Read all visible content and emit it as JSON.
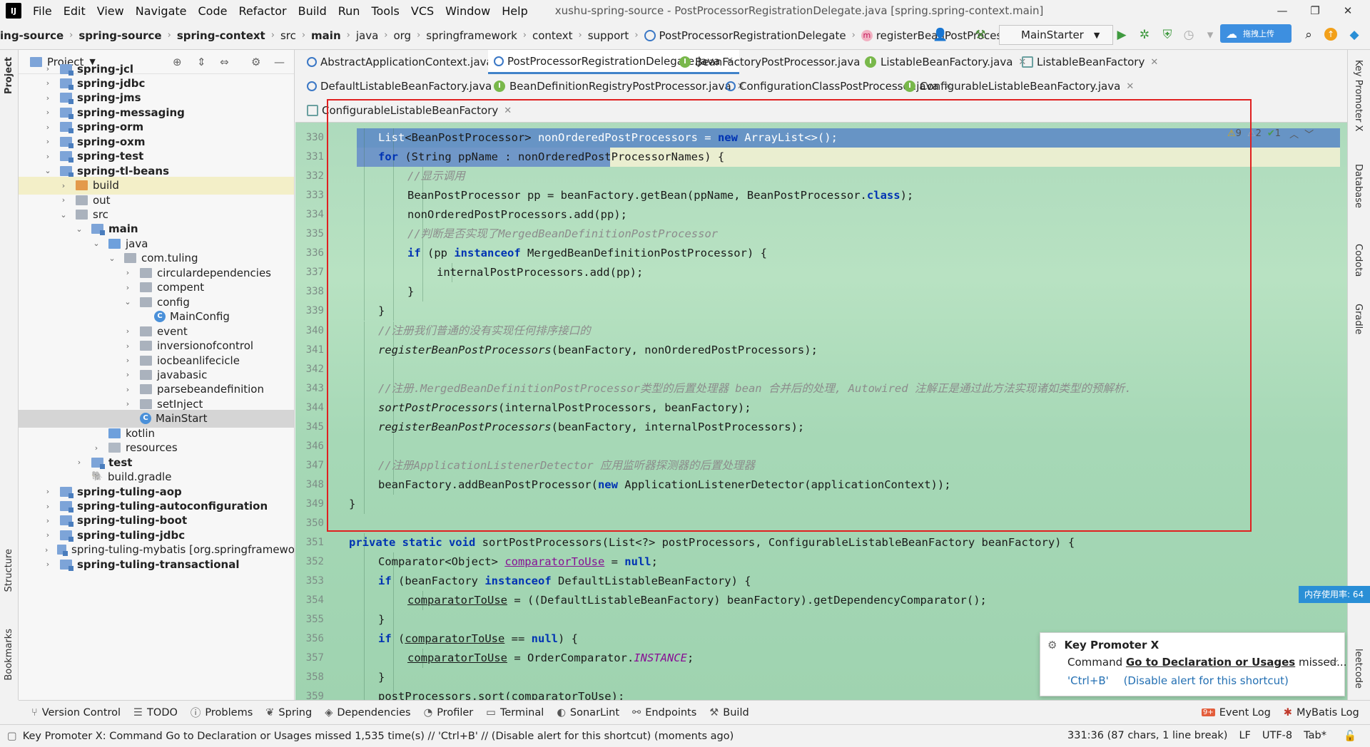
{
  "menu": [
    "File",
    "Edit",
    "View",
    "Navigate",
    "Code",
    "Refactor",
    "Build",
    "Run",
    "Tools",
    "VCS",
    "Window",
    "Help"
  ],
  "window_title": "xushu-spring-source - PostProcessorRegistrationDelegate.java [spring.spring-context.main]",
  "breadcrumbs": [
    "ing-source",
    "spring-source",
    "spring-context",
    "src",
    "main",
    "java",
    "org",
    "springframework",
    "context",
    "support",
    "PostProcessorRegistrationDelegate",
    "registerBeanPostProcessors"
  ],
  "run_config": "MainStarter",
  "upload_label": "拖拽上传",
  "project_panel": {
    "title": "Project",
    "tree": [
      {
        "label": "spring-jcl",
        "bold": true,
        "indent": 0,
        "arrow": "›",
        "icon": "module"
      },
      {
        "label": "spring-jdbc",
        "bold": true,
        "indent": 0,
        "arrow": "›",
        "icon": "module"
      },
      {
        "label": "spring-jms",
        "bold": true,
        "indent": 0,
        "arrow": "›",
        "icon": "module"
      },
      {
        "label": "spring-messaging",
        "bold": true,
        "indent": 0,
        "arrow": "›",
        "icon": "module"
      },
      {
        "label": "spring-orm",
        "bold": true,
        "indent": 0,
        "arrow": "›",
        "icon": "module"
      },
      {
        "label": "spring-oxm",
        "bold": true,
        "indent": 0,
        "arrow": "›",
        "icon": "module"
      },
      {
        "label": "spring-test",
        "bold": true,
        "indent": 0,
        "arrow": "›",
        "icon": "module"
      },
      {
        "label": "spring-tl-beans",
        "bold": true,
        "indent": 0,
        "arrow": "⌄",
        "icon": "module"
      },
      {
        "label": "build",
        "bold": false,
        "indent": 1,
        "arrow": "›",
        "icon": "orange"
      },
      {
        "label": "out",
        "bold": false,
        "indent": 1,
        "arrow": "›",
        "icon": "gray"
      },
      {
        "label": "src",
        "bold": false,
        "indent": 1,
        "arrow": "⌄",
        "icon": "gray"
      },
      {
        "label": "main",
        "bold": true,
        "indent": 2,
        "arrow": "⌄",
        "icon": "module"
      },
      {
        "label": "java",
        "bold": false,
        "indent": 3,
        "arrow": "⌄",
        "icon": "src"
      },
      {
        "label": "com.tuling",
        "bold": false,
        "indent": 4,
        "arrow": "⌄",
        "icon": "gray"
      },
      {
        "label": "circulardependencies",
        "bold": false,
        "indent": 5,
        "arrow": "›",
        "icon": "gray"
      },
      {
        "label": "compent",
        "bold": false,
        "indent": 5,
        "arrow": "›",
        "icon": "gray"
      },
      {
        "label": "config",
        "bold": false,
        "indent": 5,
        "arrow": "⌄",
        "icon": "gray"
      },
      {
        "label": "MainConfig",
        "bold": false,
        "indent": 6,
        "arrow": "",
        "icon": "class"
      },
      {
        "label": "event",
        "bold": false,
        "indent": 5,
        "arrow": "›",
        "icon": "gray"
      },
      {
        "label": "inversionofcontrol",
        "bold": false,
        "indent": 5,
        "arrow": "›",
        "icon": "gray"
      },
      {
        "label": "iocbeanlifecicle",
        "bold": false,
        "indent": 5,
        "arrow": "›",
        "icon": "gray"
      },
      {
        "label": "javabasic",
        "bold": false,
        "indent": 5,
        "arrow": "›",
        "icon": "gray"
      },
      {
        "label": "parsebeandefinition",
        "bold": false,
        "indent": 5,
        "arrow": "›",
        "icon": "gray"
      },
      {
        "label": "setInject",
        "bold": false,
        "indent": 5,
        "arrow": "›",
        "icon": "gray"
      },
      {
        "label": "MainStart",
        "bold": false,
        "indent": 5,
        "arrow": "",
        "icon": "class",
        "selected": true
      },
      {
        "label": "kotlin",
        "bold": false,
        "indent": 3,
        "arrow": "",
        "icon": "src"
      },
      {
        "label": "resources",
        "bold": false,
        "indent": 3,
        "arrow": "›",
        "icon": "res"
      },
      {
        "label": "test",
        "bold": true,
        "indent": 2,
        "arrow": "›",
        "icon": "module"
      },
      {
        "label": "build.gradle",
        "bold": false,
        "indent": 2,
        "arrow": "",
        "icon": "gradle"
      },
      {
        "label": "spring-tuling-aop",
        "bold": true,
        "indent": 0,
        "arrow": "›",
        "icon": "module"
      },
      {
        "label": "spring-tuling-autoconfiguration",
        "bold": true,
        "indent": 0,
        "arrow": "›",
        "icon": "module"
      },
      {
        "label": "spring-tuling-boot",
        "bold": true,
        "indent": 0,
        "arrow": "›",
        "icon": "module"
      },
      {
        "label": "spring-tuling-jdbc",
        "bold": true,
        "indent": 0,
        "arrow": "›",
        "icon": "module"
      },
      {
        "label": "spring-tuling-mybatis [org.springframewo",
        "bold": false,
        "indent": 0,
        "arrow": "›",
        "icon": "module",
        "bold_prefix": "spring-tuling-mybatis"
      },
      {
        "label": "spring-tuling-transactional",
        "bold": true,
        "indent": 0,
        "arrow": "›",
        "icon": "module"
      }
    ]
  },
  "tabs_row1": [
    {
      "label": "AbstractApplicationContext.java",
      "icon": "class",
      "active": false
    },
    {
      "label": "PostProcessorRegistrationDelegate.java",
      "icon": "class",
      "active": true
    },
    {
      "label": "BeanFactoryPostProcessor.java",
      "icon": "interface",
      "active": false
    },
    {
      "label": "ListableBeanFactory.java",
      "icon": "interface",
      "active": false
    },
    {
      "label": "ListableBeanFactory",
      "icon": "pin",
      "active": false
    }
  ],
  "tabs_row2": [
    {
      "label": "DefaultListableBeanFactory.java",
      "icon": "class"
    },
    {
      "label": "BeanDefinitionRegistryPostProcessor.java",
      "icon": "interface"
    },
    {
      "label": "ConfigurationClassPostProcessor.java",
      "icon": "class"
    },
    {
      "label": "ConfigurableListableBeanFactory.java",
      "icon": "interface"
    }
  ],
  "tabs_row3": [
    {
      "label": "ConfigurableListableBeanFactory",
      "icon": "pin"
    }
  ],
  "inspections": {
    "warnings": "9",
    "weak": "2",
    "ok": "1"
  },
  "code_lines": [
    {
      "n": "330",
      "indent": 2,
      "html": "List<span class=\"ty\">&lt;BeanPostProcessor&gt;</span> nonOrderedPostProcessors = <span class=\"kw\">new</span> ArrayList&lt;&gt;();",
      "sel": true
    },
    {
      "n": "331",
      "indent": 2,
      "html": "<span class=\"kw\">for</span> (String ppName : nonOrderedPostProcessorNames) {",
      "sel": "partial"
    },
    {
      "n": "332",
      "indent": 3,
      "html": "<span class=\"cm\">//显示调用</span>"
    },
    {
      "n": "333",
      "indent": 3,
      "html": "BeanPostProcessor pp = beanFactory.getBean(ppName, BeanPostProcessor.<span class=\"kw\">class</span>);"
    },
    {
      "n": "334",
      "indent": 3,
      "html": "nonOrderedPostProcessors.add(pp);"
    },
    {
      "n": "335",
      "indent": 3,
      "html": "<span class=\"cm\">//判断是否实现了MergedBeanDefinitionPostProcessor</span>"
    },
    {
      "n": "336",
      "indent": 3,
      "html": "<span class=\"kw\">if</span> (pp <span class=\"kw\">instanceof</span> MergedBeanDefinitionPostProcessor) {"
    },
    {
      "n": "337",
      "indent": 4,
      "html": "internalPostProcessors.add(pp);"
    },
    {
      "n": "338",
      "indent": 3,
      "html": "}"
    },
    {
      "n": "339",
      "indent": 2,
      "html": "}"
    },
    {
      "n": "340",
      "indent": 2,
      "html": "<span class=\"cm\">//注册我们普通的没有实现任何排序接口的</span>"
    },
    {
      "n": "341",
      "indent": 2,
      "html": "<span class=\"it\">registerBeanPostProcessors</span>(beanFactory, nonOrderedPostProcessors);"
    },
    {
      "n": "342",
      "indent": 2,
      "html": ""
    },
    {
      "n": "343",
      "indent": 2,
      "html": "<span class=\"cm\">//注册.MergedBeanDefinitionPostProcessor类型的后置处理器 bean 合并后的处理, Autowired 注解正是通过此方法实现诸如类型的预解析.</span>"
    },
    {
      "n": "344",
      "indent": 2,
      "html": "<span class=\"it\">sortPostProcessors</span>(internalPostProcessors, beanFactory);"
    },
    {
      "n": "345",
      "indent": 2,
      "html": "<span class=\"it\">registerBeanPostProcessors</span>(beanFactory, internalPostProcessors);"
    },
    {
      "n": "346",
      "indent": 2,
      "html": ""
    },
    {
      "n": "347",
      "indent": 2,
      "html": "<span class=\"cm\">//注册ApplicationListenerDetector 应用监听器探测器的后置处理器</span>"
    },
    {
      "n": "348",
      "indent": 2,
      "html": "beanFactory.addBeanPostProcessor(<span class=\"kw\">new</span> ApplicationListenerDetector(applicationContext));"
    },
    {
      "n": "349",
      "indent": 1,
      "html": "}"
    },
    {
      "n": "350",
      "indent": 0,
      "html": ""
    },
    {
      "n": "351",
      "indent": 1,
      "html": "<span class=\"kw\">private static void</span> sortPostProcessors(List&lt;?&gt; postProcessors, ConfigurableListableBeanFactory beanFactory) {"
    },
    {
      "n": "352",
      "indent": 2,
      "html": "Comparator&lt;Object&gt; <span class=\"fld\" style=\"text-decoration:underline\">comparatorToUse</span> = <span class=\"kw\">null</span>;"
    },
    {
      "n": "353",
      "indent": 2,
      "html": "<span class=\"kw\">if</span> (beanFactory <span class=\"kw\">instanceof</span> DefaultListableBeanFactory) {"
    },
    {
      "n": "354",
      "indent": 3,
      "html": "<span style=\"text-decoration:underline\">comparatorToUse</span> = ((DefaultListableBeanFactory) beanFactory).getDependencyComparator();"
    },
    {
      "n": "355",
      "indent": 2,
      "html": "}"
    },
    {
      "n": "356",
      "indent": 2,
      "html": "<span class=\"kw\">if</span> (<span style=\"text-decoration:underline\">comparatorToUse</span> == <span class=\"kw\">null</span>) {"
    },
    {
      "n": "357",
      "indent": 3,
      "html": "<span style=\"text-decoration:underline\">comparatorToUse</span> = OrderComparator.<span class=\"fld it\">INSTANCE</span>;"
    },
    {
      "n": "358",
      "indent": 2,
      "html": "}"
    },
    {
      "n": "359",
      "indent": 2,
      "html": "postProcessors.sort(<span style=\"text-decoration:underline\">comparatorToUse</span>);"
    }
  ],
  "right_tools": [
    "Key Promoter X",
    "Database",
    "Codota",
    "Gradle",
    "leetcode"
  ],
  "left_tools": [
    "Project",
    "Structure",
    "Bookmarks"
  ],
  "bottom_tools": [
    {
      "icon": "⑂",
      "label": "Version Control"
    },
    {
      "icon": "☰",
      "label": "TODO"
    },
    {
      "icon": "ⓘ",
      "label": "Problems"
    },
    {
      "icon": "❦",
      "label": "Spring"
    },
    {
      "icon": "◈",
      "label": "Dependencies"
    },
    {
      "icon": "◔",
      "label": "Profiler"
    },
    {
      "icon": "▭",
      "label": "Terminal"
    },
    {
      "icon": "◐",
      "label": "SonarLint"
    },
    {
      "icon": "⚯",
      "label": "Endpoints"
    },
    {
      "icon": "⚒",
      "label": "Build"
    }
  ],
  "bottom_right": [
    {
      "icon": "9+",
      "label": "Event Log"
    },
    {
      "icon": "✱",
      "label": "MyBatis Log"
    }
  ],
  "status_message": "Key Promoter X: Command Go to Declaration or Usages missed 1,535 time(s) // 'Ctrl+B' // (Disable alert for this shortcut) (moments ago)",
  "status_right": [
    "331:36 (87 chars, 1 line break)",
    "LF",
    "UTF-8",
    "Tab*"
  ],
  "popup": {
    "title": "Key Promoter X",
    "prefix": "Command ",
    "command": "Go to Declaration or Usages",
    "suffix": " missed...",
    "shortcut": "'Ctrl+B'",
    "disable": "(Disable alert for this shortcut)"
  },
  "memory_tip": "内存使用率: 64"
}
